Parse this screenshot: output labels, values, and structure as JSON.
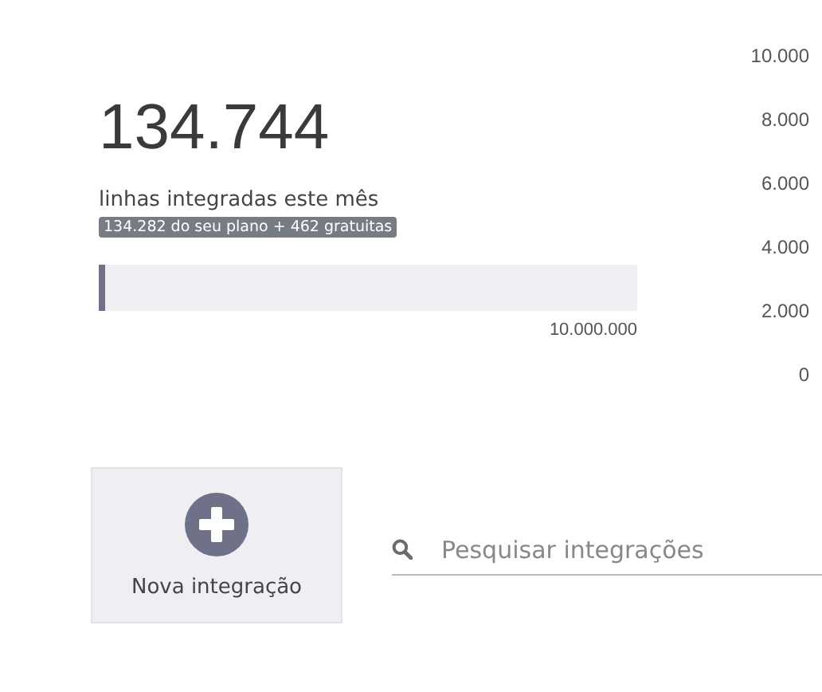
{
  "usage": {
    "total": "134.744",
    "label": "linhas integradas este mês",
    "badge": "134.282 do seu plano + 462 gratuitas",
    "level": 0.012,
    "limit": "10.000.000"
  },
  "axis_labels": [
    "10.000",
    "8.000",
    "6.000",
    "4.000",
    "2.000",
    "0"
  ],
  "new_button": {
    "label": "Nova integração"
  },
  "search": {
    "placeholder": "Pesquisar integrações"
  }
}
